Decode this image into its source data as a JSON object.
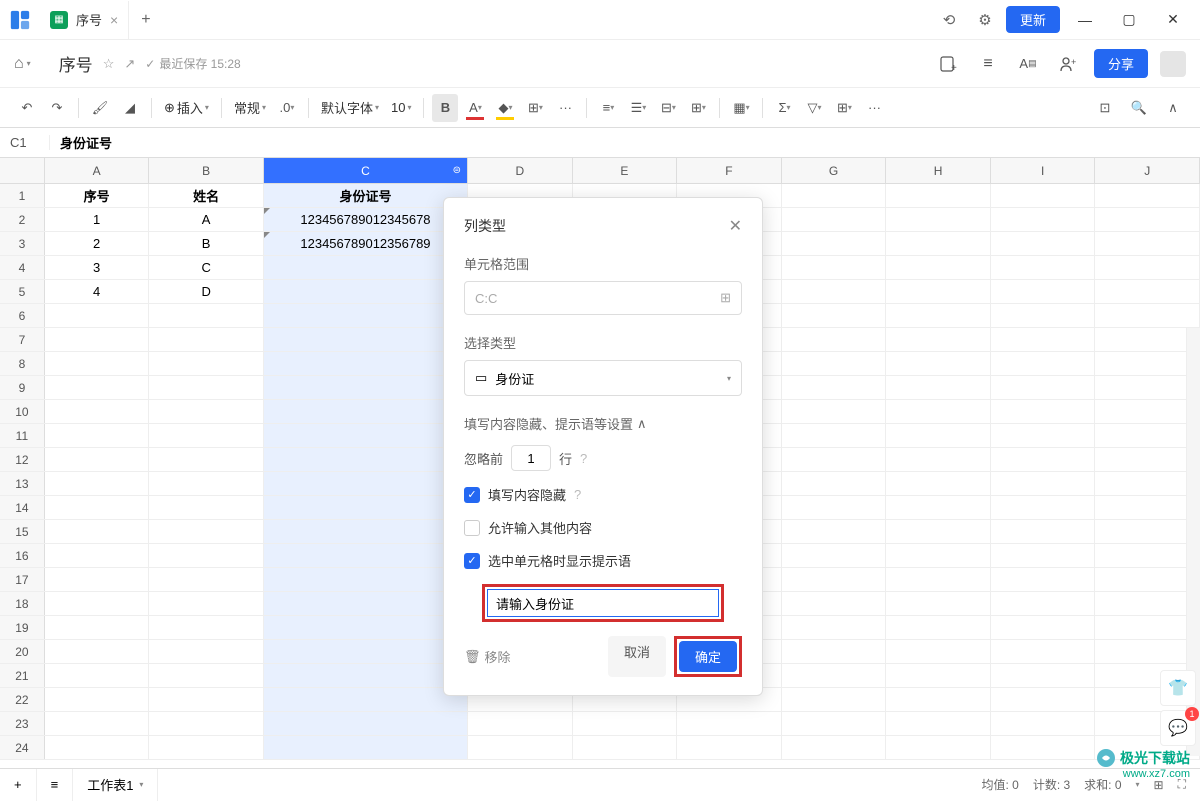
{
  "titlebar": {
    "tab_title": "序号",
    "update_btn": "更新"
  },
  "docbar": {
    "title": "序号",
    "saved": "最近保存 15:28",
    "share": "分享"
  },
  "toolbar": {
    "insert": "插入",
    "format": "常规",
    "font": "默认字体",
    "font_size": "10",
    "decimal": ".0",
    "more": "···"
  },
  "formula": {
    "cell": "C1",
    "value": "身份证号"
  },
  "columns": [
    "A",
    "B",
    "C",
    "D",
    "E",
    "F",
    "G",
    "H",
    "I",
    "J"
  ],
  "headers": {
    "a": "序号",
    "b": "姓名",
    "c": "身份证号"
  },
  "data": [
    {
      "a": "1",
      "b": "A",
      "c": "123456789012345678"
    },
    {
      "a": "2",
      "b": "B",
      "c": "123456789012356789"
    },
    {
      "a": "3",
      "b": "C",
      "c": ""
    },
    {
      "a": "4",
      "b": "D",
      "c": ""
    }
  ],
  "popup": {
    "title": "列类型",
    "range_label": "单元格范围",
    "range_value": "C:C",
    "type_label": "选择类型",
    "type_value": "身份证",
    "section": "填写内容隐藏、提示语等设置",
    "skip_prefix": "忽略前",
    "skip_val": "1",
    "skip_suffix": "行",
    "chk_hide": "填写内容隐藏",
    "chk_other": "允许输入其他内容",
    "chk_hint": "选中单元格时显示提示语",
    "hint_value": "请输入身份证",
    "remove": "移除",
    "cancel": "取消",
    "confirm": "确定"
  },
  "bottom": {
    "sheet": "工作表1",
    "stats_avg": "均值: 0",
    "stats_count": "计数: 3",
    "stats_sum": "求和: 0"
  },
  "watermark": {
    "site": "极光下载站",
    "url": "www.xz7.com"
  },
  "badge": "1"
}
